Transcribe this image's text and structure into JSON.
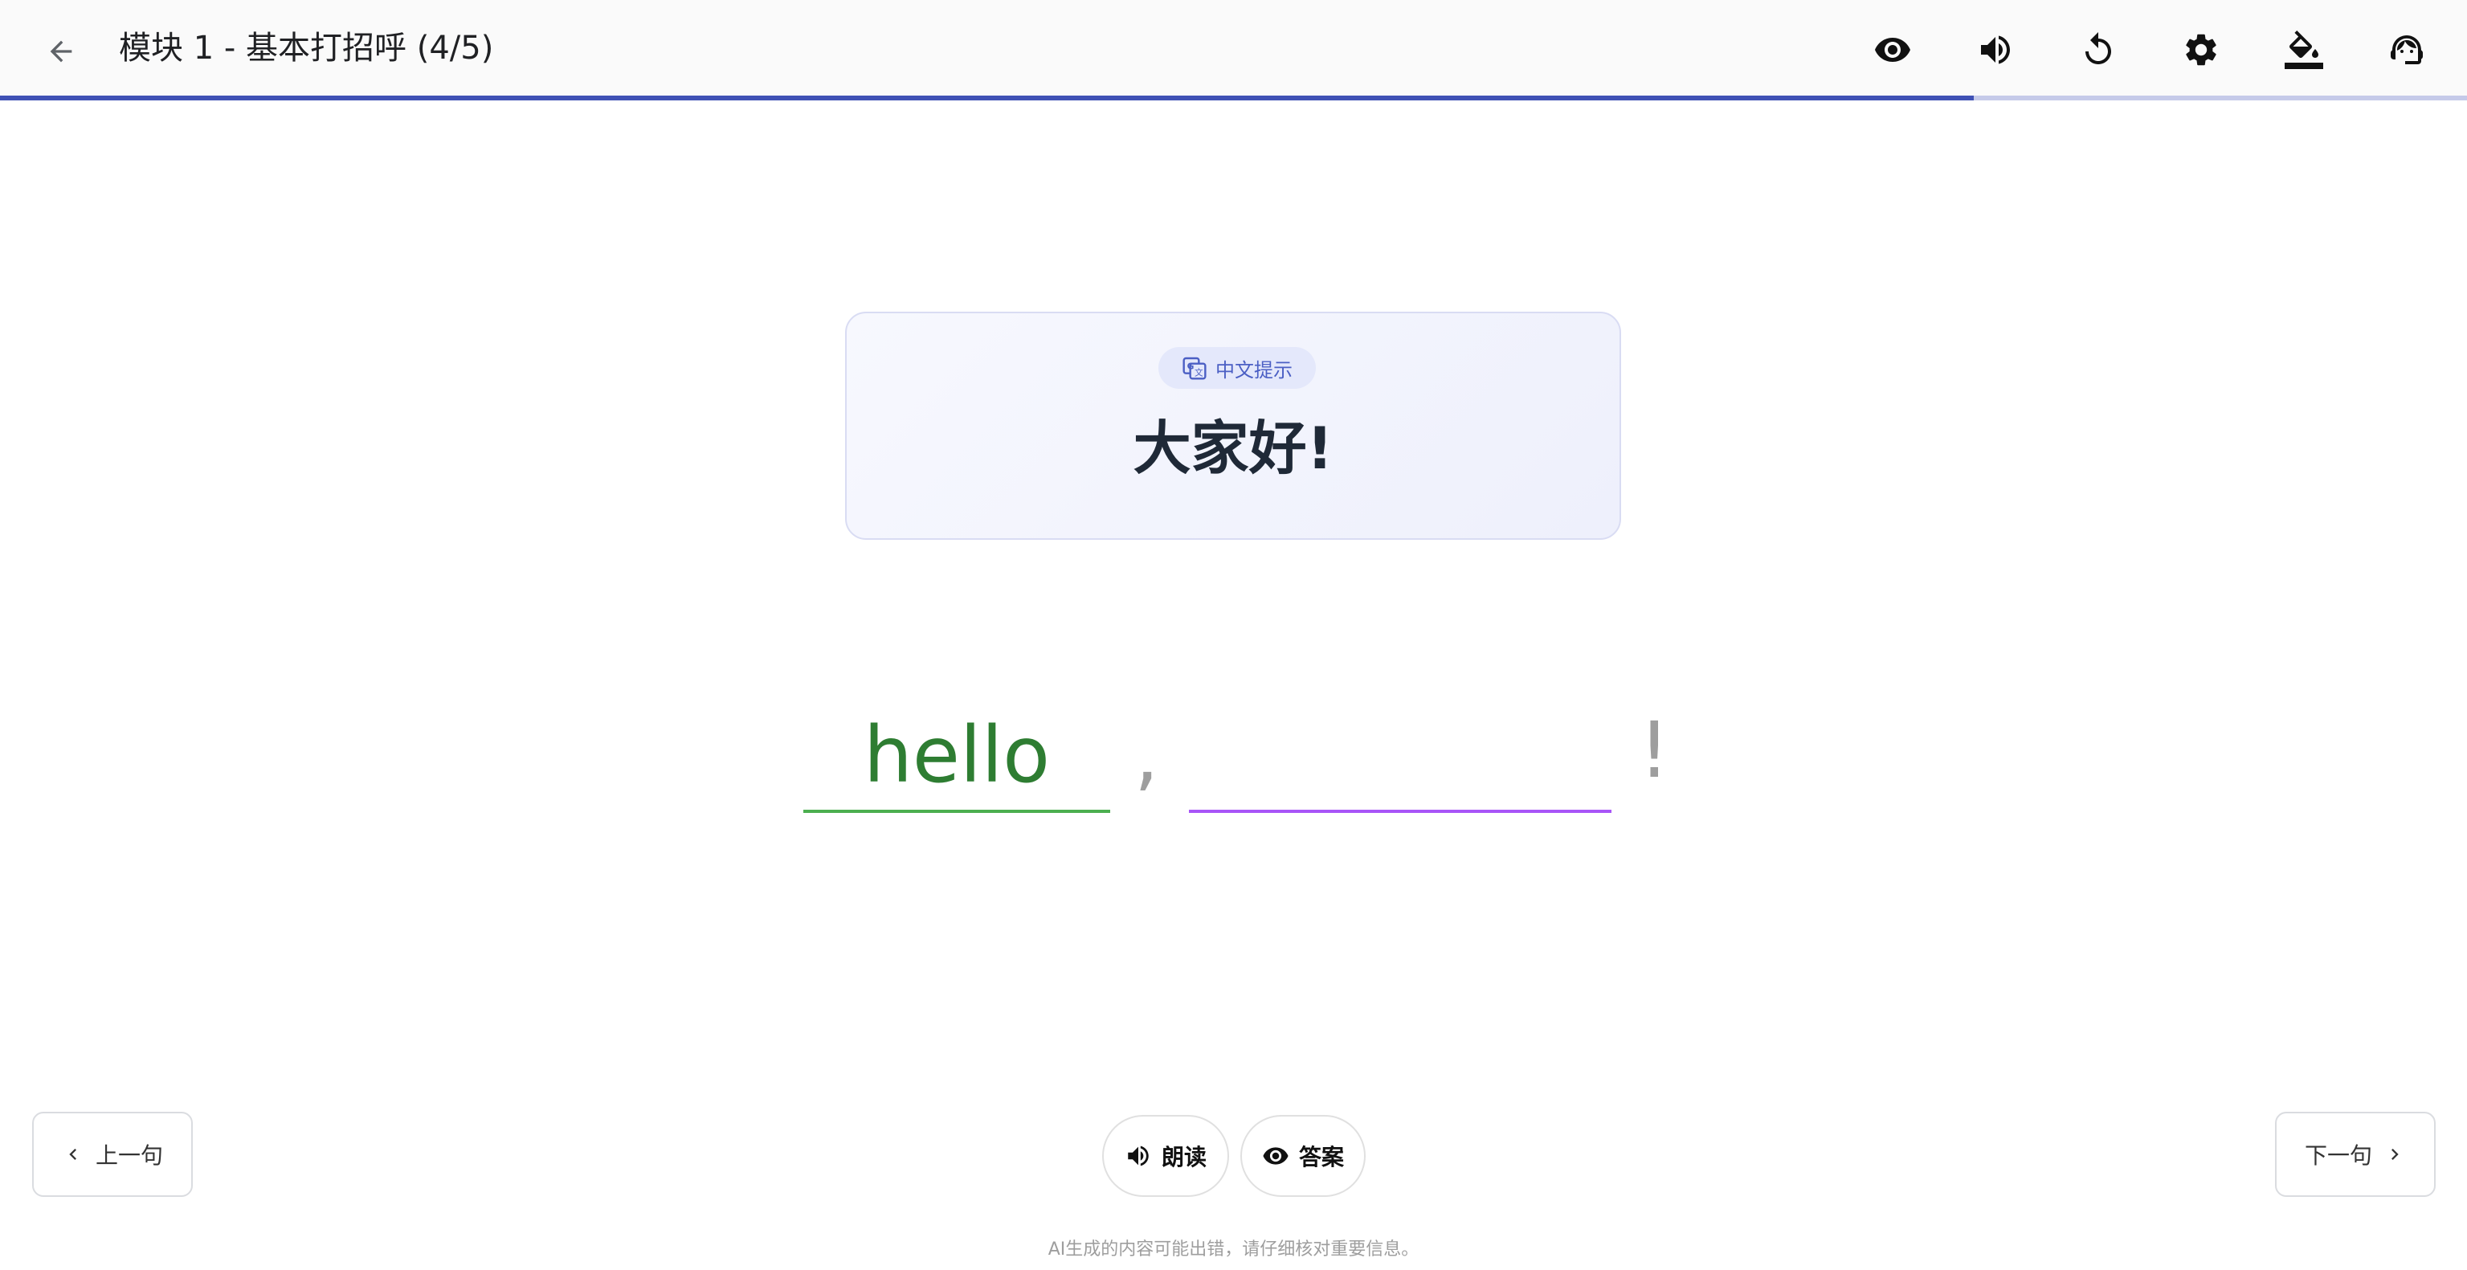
{
  "header": {
    "title": "模块 1 - 基本打招呼 (4/5)",
    "progress": 0.8,
    "icons": [
      "visibility-icon",
      "volume-icon",
      "refresh-icon",
      "settings-icon",
      "paint-bucket-icon",
      "support-agent-icon"
    ]
  },
  "hint": {
    "badge_label": "中文提示",
    "text": "大家好!"
  },
  "sentence": {
    "word1": "hello",
    "comma": ",",
    "word2": "",
    "end_punct": "!"
  },
  "footer": {
    "prev_label": "上一句",
    "next_label": "下一句",
    "read_label": "朗读",
    "answer_label": "答案",
    "disclaimer": "AI生成的内容可能出错，请仔细核对重要信息。"
  },
  "colors": {
    "accent": "#3f51b5",
    "correct": "#2e7d32",
    "active_underline": "#a855f7"
  }
}
